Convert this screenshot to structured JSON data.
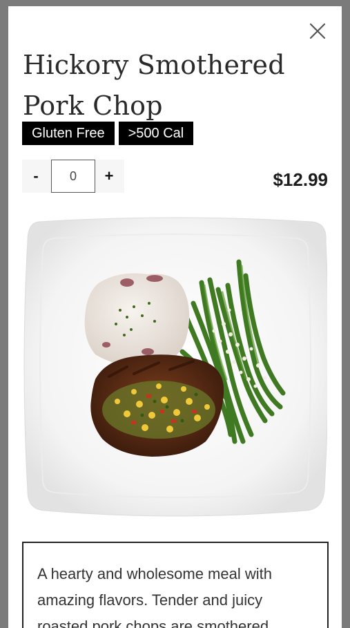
{
  "item": {
    "title": "Hickory Smothered Pork Chop",
    "tags": [
      "Gluten Free",
      ">500 Cal"
    ],
    "price": "$12.99",
    "description": "A hearty and wholesome meal with amazing flavors. Tender and juicy roasted pork chops are smothered"
  },
  "quantity": {
    "minus_label": "-",
    "value": "0",
    "plus_label": "+"
  },
  "icons": {
    "close": "close-icon"
  },
  "colors": {
    "overlay": "#7b7b7b",
    "tag_bg": "#000000",
    "tag_text": "#ffffff",
    "price": "#1c1c1c"
  }
}
